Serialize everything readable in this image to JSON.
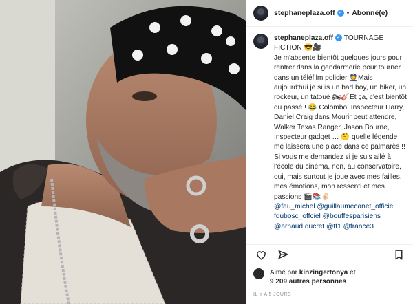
{
  "header": {
    "username": "stephaneplaza.off",
    "separator": "•",
    "follow_label": "Abonné(e)"
  },
  "caption": {
    "username": "stephaneplaza.off",
    "text": " TOURNAGE FICTION 😎🎥\nJe m'absente bientôt quelques jours pour rentrer dans la gendarmerie pour tourner dans un téléfilm policier 👮Mais aujourd'hui je suis un bad boy, un biker, un rockeur, un tatoué 🏍🎸Et ça, c'est bientôt du passé ! 😂 Colombo, Inspecteur Harry, Daniel Craig dans Mourir peut attendre, Walker Texas Ranger, Jason Bourne, Inspecteur gadget … 🤔 quelle légende me laissera une place dans ce palmarès !! Si vous me demandez si je suis allé à l'école du cinéma, non, au conservatoire, oui, mais surtout je joue avec mes failles, mes émotions, mon ressenti et mes passions 🎬📚✌🏻",
    "mentions": [
      "@fau_michel",
      "@guillaumecanet_officiel",
      "fdubosc_offciel",
      "@bouffesparisiens",
      "@arnaud.ducret",
      "@tf1",
      "@france3"
    ]
  },
  "likes": {
    "prefix": "Aimé par ",
    "user": "kinzingertonya",
    "and": " et",
    "count": "9 209 autres personnes"
  },
  "timestamp": "IL Y A 5 JOURS",
  "icons": [
    "heart-icon",
    "share-icon",
    "bookmark-icon"
  ],
  "colors": {
    "verified": "#3897f0",
    "mention": "#00376b",
    "border": "#efefef"
  }
}
